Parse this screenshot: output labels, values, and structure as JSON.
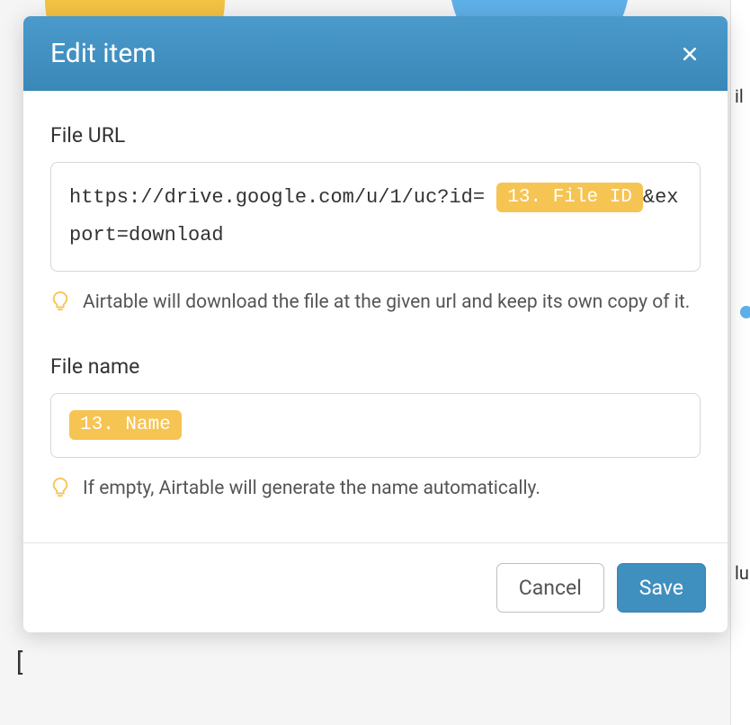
{
  "modal": {
    "title": "Edit item",
    "fields": {
      "url": {
        "label": "File URL",
        "prefix": "https://drive.google.com/u/1/uc?id=",
        "token": "13. File ID",
        "suffix": "&export=download",
        "hint": "Airtable will download the file at the given url and keep its own copy of it."
      },
      "name": {
        "label": "File name",
        "token": "13. Name",
        "hint": "If empty, Airtable will generate the name automatically."
      }
    },
    "buttons": {
      "cancel": "Cancel",
      "save": "Save"
    }
  }
}
